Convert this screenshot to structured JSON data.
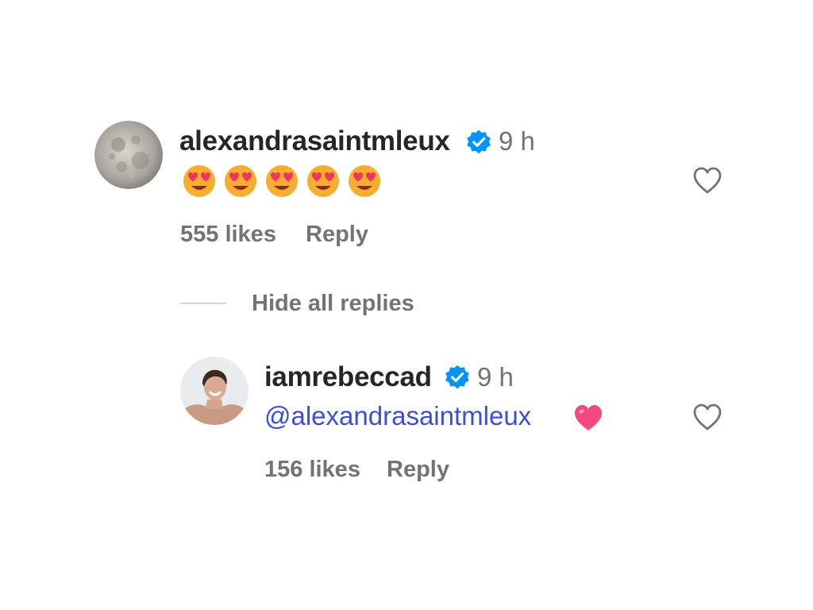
{
  "comment": {
    "username": "alexandrasaintmleux",
    "verified": true,
    "time": "9 h",
    "emojis": [
      "smiling-face-with-heart-eyes",
      "smiling-face-with-heart-eyes",
      "smiling-face-with-heart-eyes",
      "smiling-face-with-heart-eyes",
      "smiling-face-with-heart-eyes"
    ],
    "likes": "555 likes",
    "reply_label": "Reply"
  },
  "thread": {
    "toggle_label": "Hide all replies"
  },
  "reply": {
    "username": "iamrebeccad",
    "verified": true,
    "time": "9 h",
    "mention": "@alexandrasaintmleux",
    "trailing_emoji": "pink-heart",
    "likes": "156 likes",
    "reply_label": "Reply"
  },
  "colors": {
    "verified_badge": "#0095f6",
    "mention_link": "#3b4fd6",
    "secondary_text": "#737373",
    "heart_emoji": "#f4497e"
  }
}
